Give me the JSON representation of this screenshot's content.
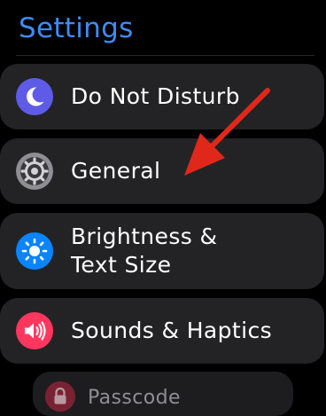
{
  "header": {
    "title": "Settings"
  },
  "menu": {
    "items": [
      {
        "label": "Do Not Disturb",
        "icon": "moon-icon",
        "icon_color": "#5e5ce6"
      },
      {
        "label": "General",
        "icon": "gear-icon",
        "icon_color": "#8e8e93"
      },
      {
        "label_line1": "Brightness &",
        "label_line2": "Text Size",
        "icon": "sun-icon",
        "icon_color": "#0a84ff"
      },
      {
        "label": "Sounds & Haptics",
        "icon": "speaker-icon",
        "icon_color": "#ff375f"
      },
      {
        "label": "Passcode",
        "icon": "lock-icon",
        "icon_color": "#ff375f"
      }
    ]
  },
  "annotation": {
    "icon": "red-arrow-pointer",
    "color": "#e0281a"
  },
  "colors": {
    "accent": "#3f8bf4",
    "row_background": "#232325",
    "background": "#000000"
  }
}
